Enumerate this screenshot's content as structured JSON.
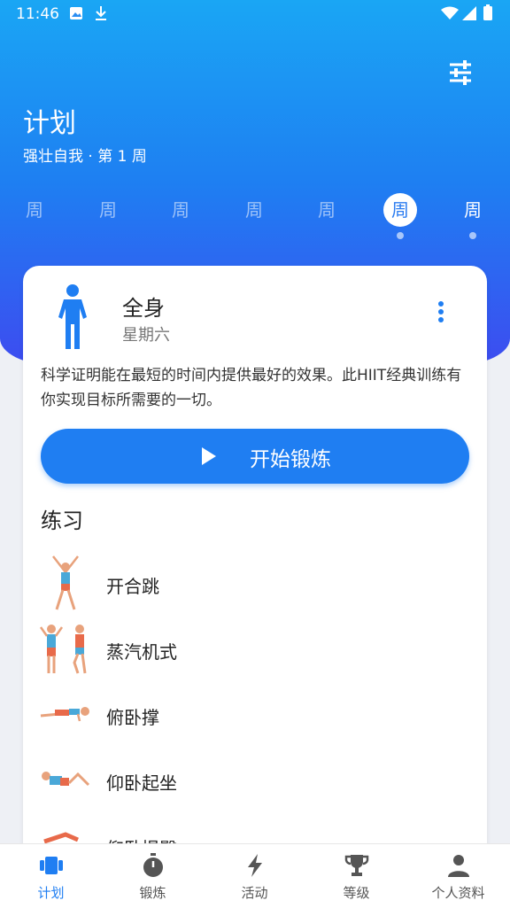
{
  "status_bar": {
    "time": "11:46"
  },
  "header": {
    "title": "计划",
    "subtitle": "强壮自我 · 第 1 周"
  },
  "days": [
    {
      "label": "周"
    },
    {
      "label": "周"
    },
    {
      "label": "周"
    },
    {
      "label": "周"
    },
    {
      "label": "周"
    },
    {
      "label": "周"
    },
    {
      "label": "周"
    }
  ],
  "workout": {
    "name": "全身",
    "day": "星期六",
    "description": "科学证明能在最短的时间内提供最好的效果。此HIIT经典训练有你实现目标所需要的一切。",
    "start_label": "开始锻炼"
  },
  "exercises": {
    "section_title": "练习",
    "items": [
      {
        "label": "开合跳"
      },
      {
        "label": "蒸汽机式"
      },
      {
        "label": "俯卧撑"
      },
      {
        "label": "仰卧起坐"
      },
      {
        "label": "仰卧提臀"
      }
    ]
  },
  "bottom_nav": [
    {
      "label": "计划",
      "icon": "plan-icon"
    },
    {
      "label": "锻炼",
      "icon": "stopwatch-icon"
    },
    {
      "label": "活动",
      "icon": "lightning-icon"
    },
    {
      "label": "等级",
      "icon": "trophy-icon"
    },
    {
      "label": "个人资料",
      "icon": "person-icon"
    }
  ],
  "colors": {
    "accent": "#1f7ef2",
    "gradient_top": "#1aa6f4",
    "gradient_bottom": "#3d4cf0"
  }
}
